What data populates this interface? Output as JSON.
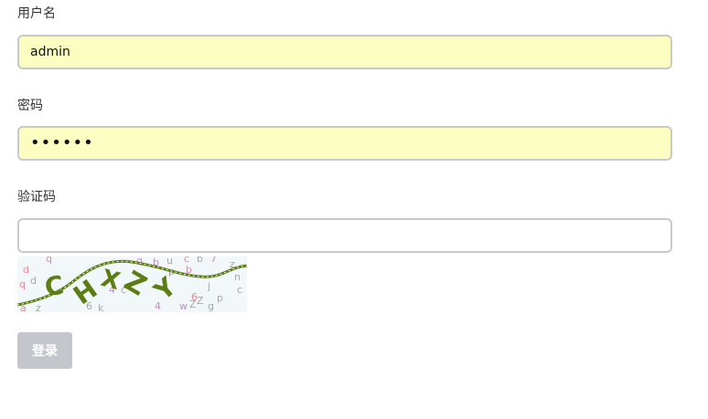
{
  "form": {
    "username": {
      "label": "用户名",
      "value": "admin"
    },
    "password": {
      "label": "密码",
      "value": "••••••"
    },
    "captcha": {
      "label": "验证码",
      "value": "",
      "image_text": "CHXZY"
    },
    "submit_label": "登录"
  },
  "colors": {
    "autofill_background": "#fbfec0",
    "input_border": "#c9c9c9",
    "button_background": "#c3c7cb",
    "captcha_text": "#5c7d13"
  }
}
